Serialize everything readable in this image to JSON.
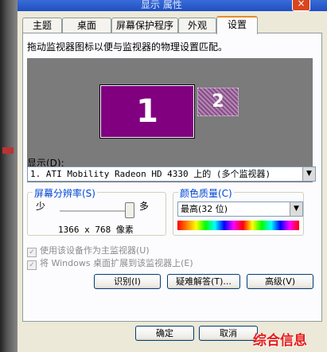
{
  "window": {
    "title": "显示 属性",
    "close_glyph": "×"
  },
  "tabs": [
    "主题",
    "桌面",
    "屏幕保护程序",
    "外观",
    "设置"
  ],
  "settings": {
    "instruction": "拖动监视器图标以便与监视器的物理设置匹配。",
    "monitors": [
      {
        "label": "1",
        "state": "active"
      },
      {
        "label": "2",
        "state": "inactive"
      }
    ],
    "display_label": "显示(D):",
    "display_value": "1. ATI Mobility Radeon HD 4330 上的 (多个监视器)",
    "resolution": {
      "legend": "屏幕分辨率(S)",
      "less_label": "少",
      "more_label": "多",
      "value_text": "1366 x 768 像素",
      "slider_level": 1.0
    },
    "color_quality": {
      "legend": "颜色质量(C)",
      "value": "最高(32 位)"
    },
    "checkboxes": [
      {
        "label": "使用该设备作为主监视器(U)",
        "checked": true,
        "enabled": false
      },
      {
        "label": "将 Windows 桌面扩展到该监视器上(E)",
        "checked": true,
        "enabled": false
      }
    ],
    "buttons": {
      "identify": "识别(I)",
      "troubleshoot": "疑难解答(T)...",
      "advanced": "高级(V)"
    }
  },
  "footer": {
    "ok": "确定",
    "cancel": "取消"
  },
  "watermark": "综合信息",
  "colors": {
    "accent_tab": "#e68b2c",
    "monitor_active": "#800080",
    "monitor_area": "#7b7b7b"
  }
}
